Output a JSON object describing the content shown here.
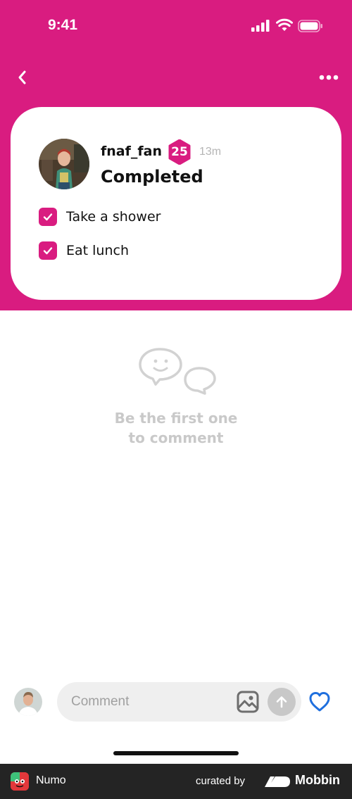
{
  "status_bar": {
    "time": "9:41"
  },
  "post": {
    "username": "fnaf_fan",
    "level": "25",
    "time_ago": "13m",
    "status": "Completed",
    "tasks": [
      {
        "label": "Take a shower",
        "checked": true
      },
      {
        "label": "Eat lunch",
        "checked": true
      }
    ]
  },
  "comments": {
    "empty_line1": "Be the first one",
    "empty_line2": "to comment"
  },
  "composer": {
    "placeholder": "Comment"
  },
  "footer": {
    "app_name": "Numo",
    "curated_by": "curated by",
    "brand": "Mobbin"
  },
  "colors": {
    "accent": "#d91c80",
    "muted": "#c9c9c9",
    "link_blue": "#1f6fde"
  }
}
